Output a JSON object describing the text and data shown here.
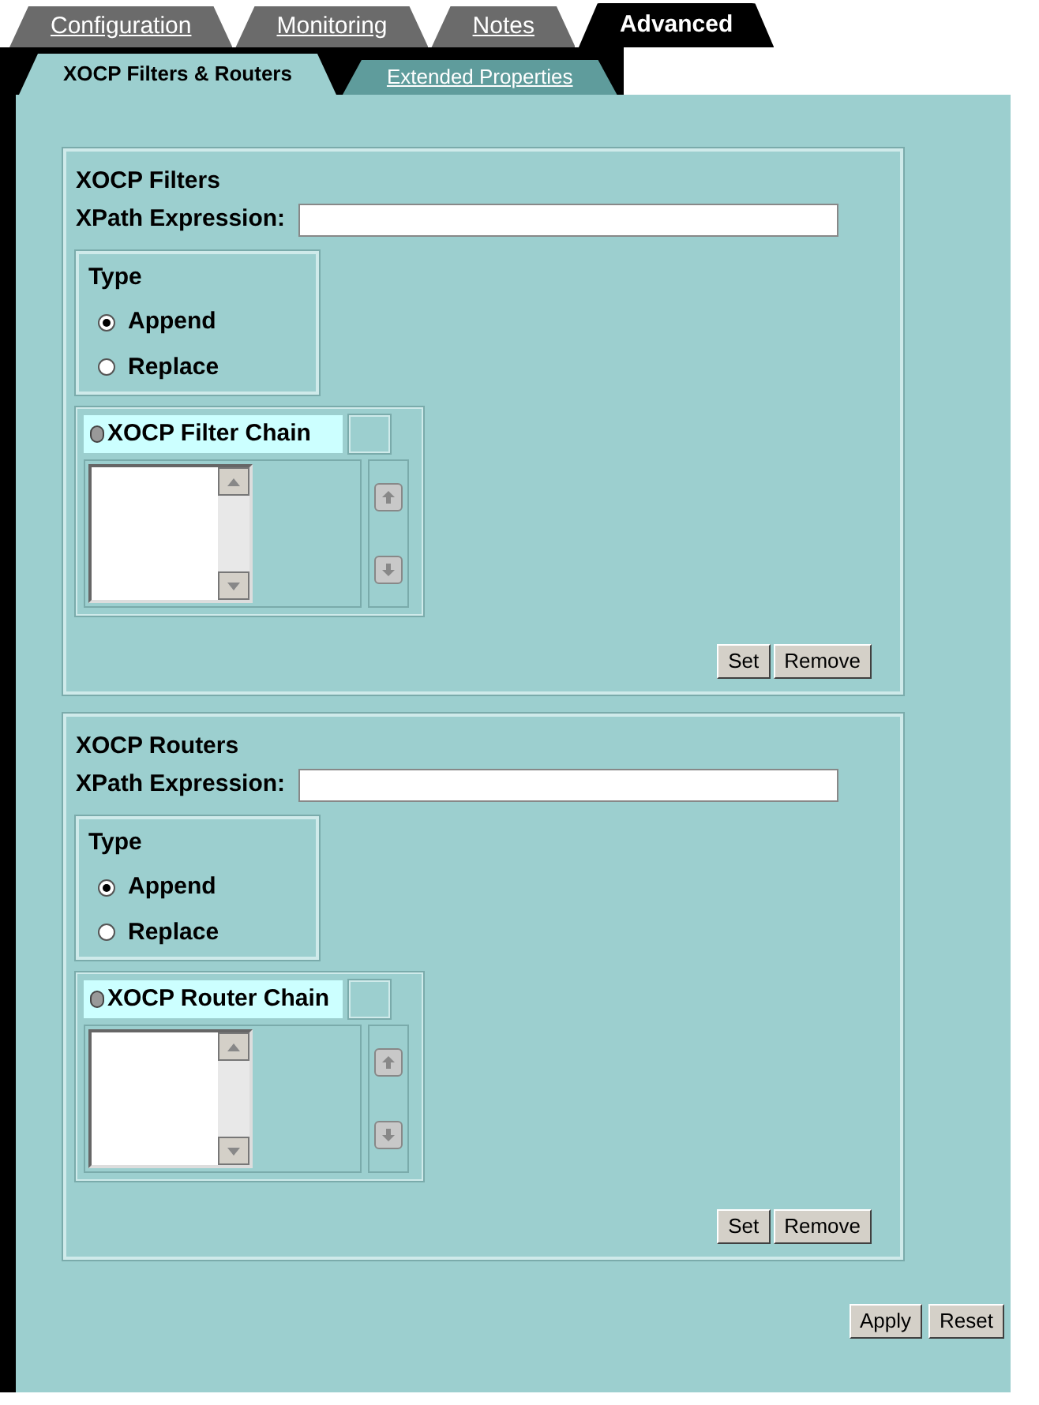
{
  "tabs": [
    {
      "label": "Configuration",
      "selected": false
    },
    {
      "label": "Monitoring",
      "selected": false
    },
    {
      "label": "Notes",
      "selected": false
    },
    {
      "label": "Advanced",
      "selected": true
    }
  ],
  "subtabs": [
    {
      "label": "XOCP Filters & Routers",
      "selected": true
    },
    {
      "label": "Extended Properties",
      "selected": false
    }
  ],
  "sections": [
    {
      "title": "XOCP Filters",
      "xpath_label": "XPath Expression:",
      "type_title": "Type",
      "options": [
        {
          "label": "Append",
          "selected": true
        },
        {
          "label": "Replace",
          "selected": false
        }
      ],
      "chain_label": "XOCP Filter Chain",
      "buttons": [
        "Set",
        "Remove"
      ]
    },
    {
      "title": "XOCP Routers",
      "xpath_label": "XPath Expression:",
      "type_title": "Type",
      "options": [
        {
          "label": "Append",
          "selected": true
        },
        {
          "label": "Replace",
          "selected": false
        }
      ],
      "chain_label": "XOCP Router Chain",
      "buttons": [
        "Set",
        "Remove"
      ]
    }
  ],
  "footer_buttons": [
    "Apply",
    "Reset"
  ]
}
